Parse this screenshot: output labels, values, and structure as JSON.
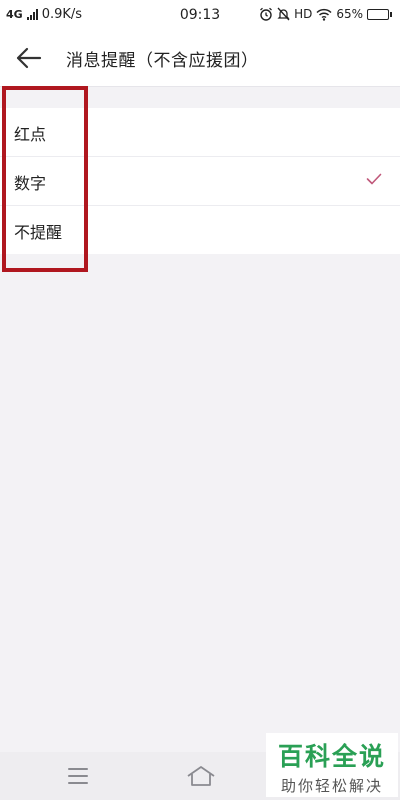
{
  "status_bar": {
    "network_type": "4G",
    "speed": "0.9K/s",
    "time": "09:13",
    "hd": "HD",
    "battery": "65%",
    "battery_level": 0.65
  },
  "header": {
    "title": "消息提醒（不含应援团）"
  },
  "options": [
    {
      "label": "红点",
      "selected": false
    },
    {
      "label": "数字",
      "selected": true
    },
    {
      "label": "不提醒",
      "selected": false
    }
  ],
  "colors": {
    "accent_check": "#c0587a",
    "highlight": "#b0171f",
    "watermark_green": "#2aa055"
  },
  "watermark": {
    "title": "百科全说",
    "subtitle": "助你轻松解决"
  }
}
